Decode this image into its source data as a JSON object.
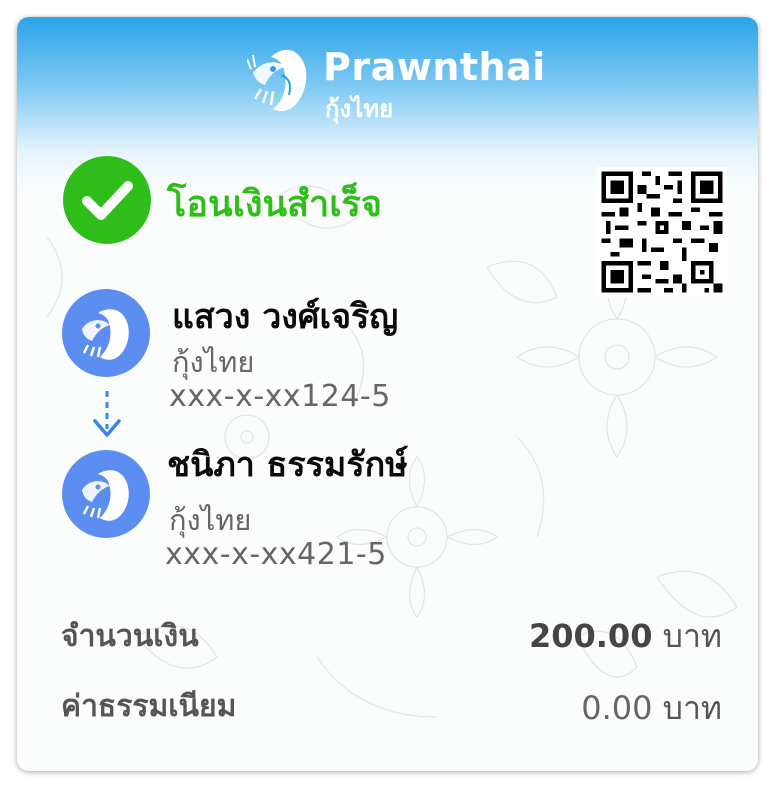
{
  "brand": {
    "name": "Prawnthai",
    "subtitle": "กุ้งไทย",
    "logo_icon": "prawn-logo-icon"
  },
  "status": {
    "text": "โอนเงินสำเร็จ",
    "icon": "check-circle-icon",
    "color": "#2ebd19"
  },
  "qr": {
    "icon": "qr-code"
  },
  "sender": {
    "name": "แสวง วงศ์เจริญ",
    "bank": "กุ้งไทย",
    "account": "xxx-x-xx124-5",
    "avatar_icon": "prawn-avatar-icon"
  },
  "receiver": {
    "name": "ชนิภา ธรรมรักษ์",
    "bank": "กุ้งไทย",
    "account": "xxx-x-xx421-5",
    "avatar_icon": "prawn-avatar-icon"
  },
  "amount": {
    "label": "จำนวนเงิน",
    "value": "200.00",
    "unit": "บาท"
  },
  "fee": {
    "label": "ค่าธรรมเนียม",
    "value": "0.00",
    "unit": "บาท"
  },
  "colors": {
    "header_blue": "#2aa3e6",
    "success_green": "#2ebd19",
    "avatar_blue": "#5b8ef0"
  }
}
